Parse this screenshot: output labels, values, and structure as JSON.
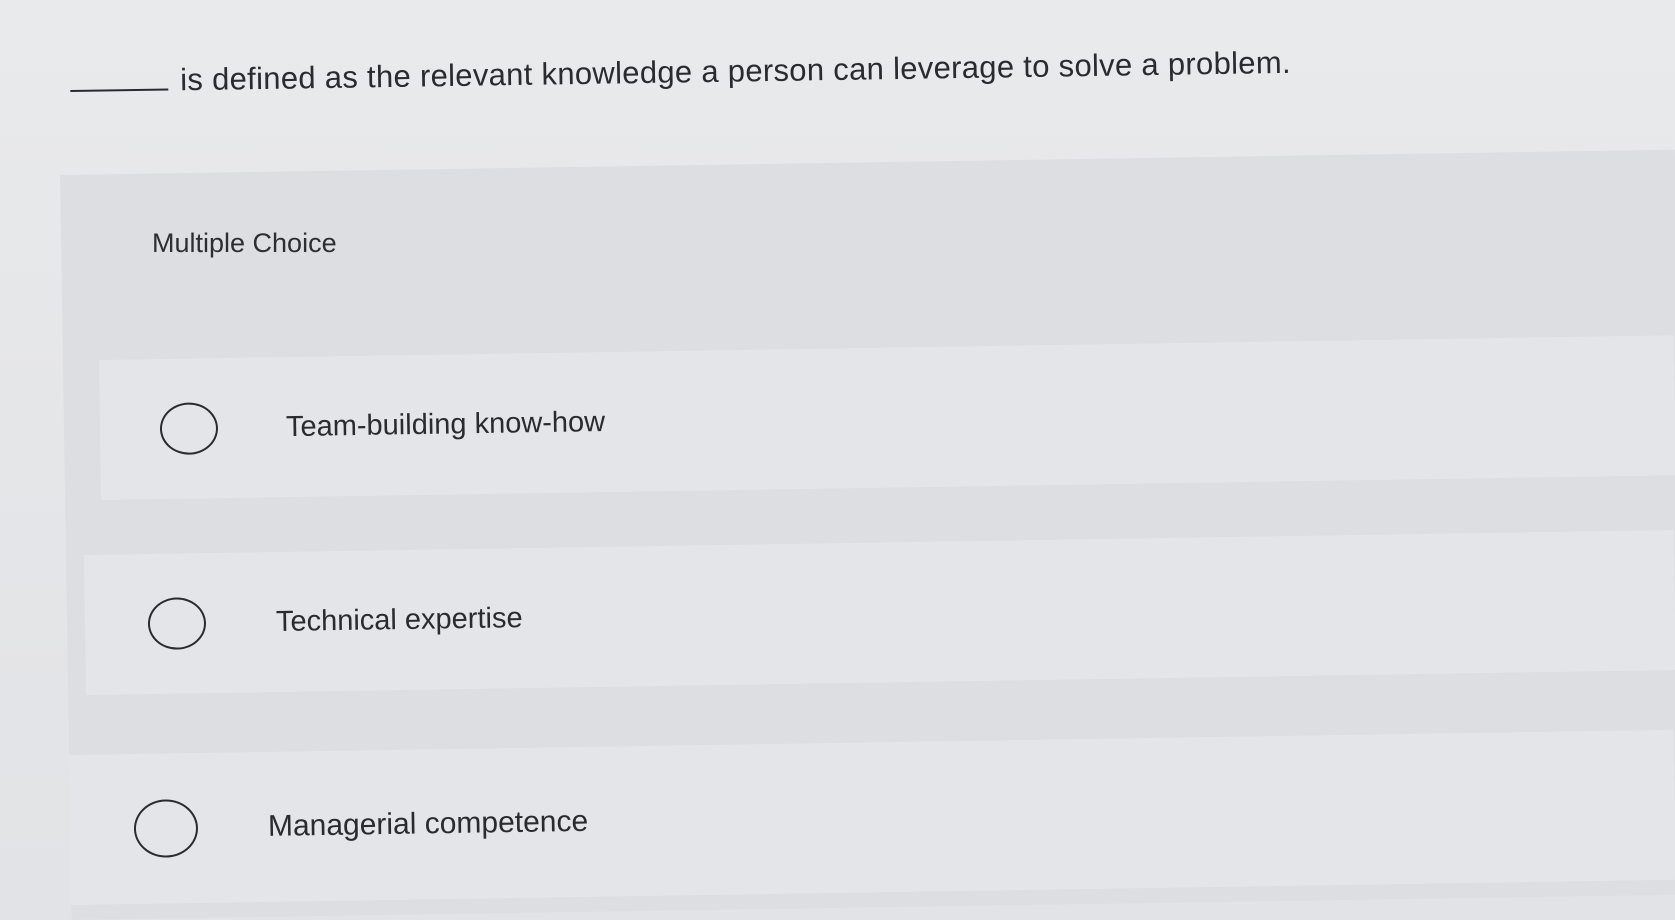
{
  "question": {
    "text": "is defined as the relevant knowledge a person can leverage to solve a problem."
  },
  "section": {
    "label": "Multiple Choice"
  },
  "options": [
    {
      "label": "Team-building know-how",
      "selected": false
    },
    {
      "label": "Technical expertise",
      "selected": false
    },
    {
      "label": "Managerial competence",
      "selected": false
    }
  ]
}
